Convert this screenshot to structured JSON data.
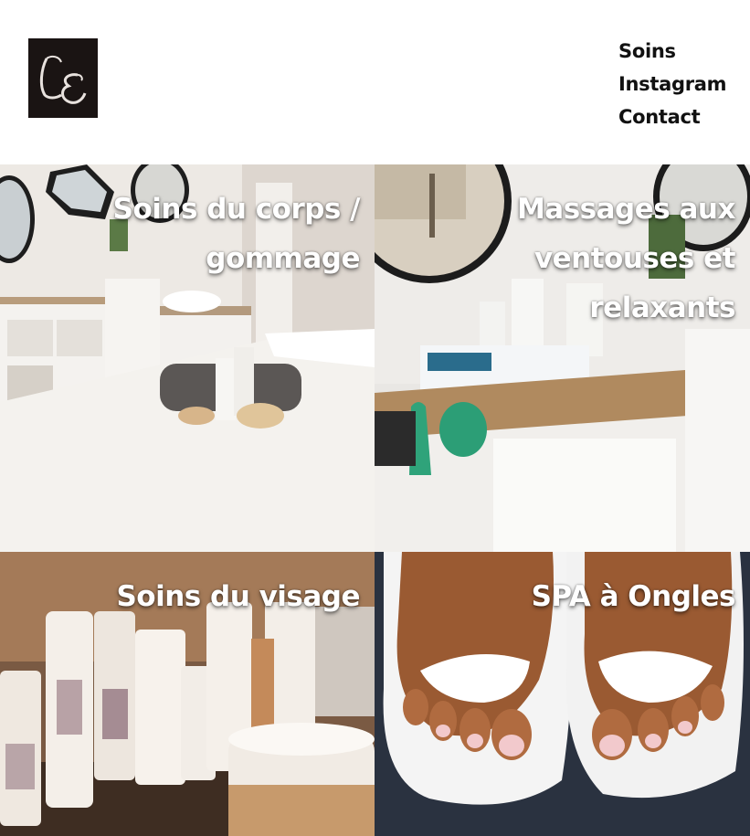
{
  "header": {
    "logo_text": "LE",
    "nav": {
      "soins": "Soins",
      "instagram": "Instagram",
      "contact": "Contact"
    }
  },
  "tiles": [
    {
      "line1": "Soins du corps /",
      "line2": "gommage",
      "line3": ""
    },
    {
      "line1": "Massages aux",
      "line2": "ventouses et",
      "line3": "relaxants"
    },
    {
      "line1": "Soins du visage",
      "line2": "",
      "line3": ""
    },
    {
      "line1": "SPA à Ongles",
      "line2": "",
      "line3": ""
    }
  ],
  "colors": {
    "logo_bg": "#1a1413",
    "logo_letters": "#e8e2de",
    "nav_text": "#111111",
    "title_text": "#ffffff"
  }
}
